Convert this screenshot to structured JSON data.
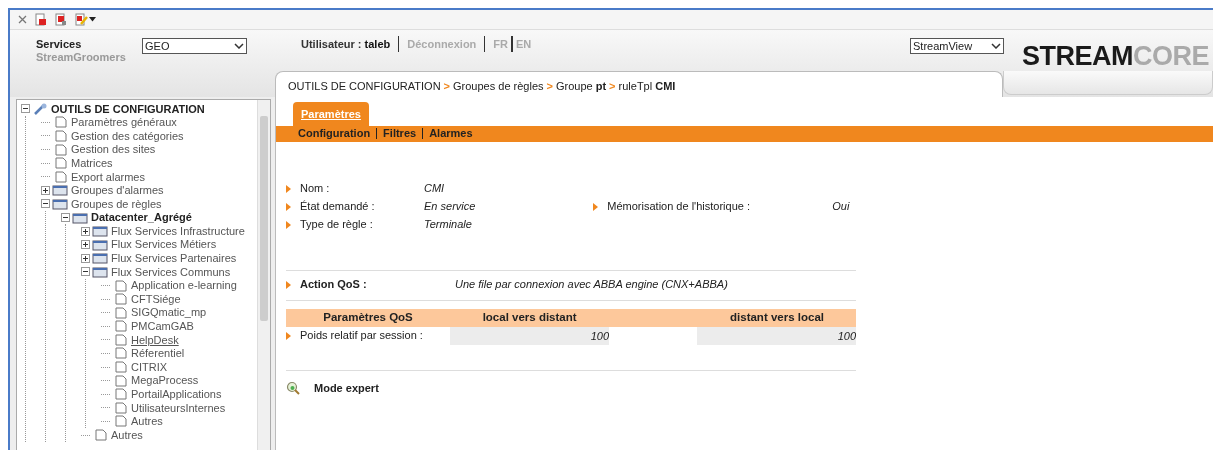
{
  "header": {
    "services_label": "Services",
    "services_sub": "StreamGroomers",
    "services_select": "GEO",
    "user_label": "Utilisateur :",
    "user_name": "taleb",
    "logout": "Déconnexion",
    "languages": [
      "FR",
      "EN"
    ],
    "app_select": "StreamView",
    "logo": [
      "STREAM",
      "CORE"
    ]
  },
  "breadcrumb": [
    {
      "label": "OUTILS DE CONFIGURATION",
      "separator": ">"
    },
    {
      "label": "Groupes de règles",
      "separator": ">"
    },
    {
      "label": "Groupe **pt**",
      "separator": ">"
    },
    {
      "label": "ruleTpl **CMI**"
    }
  ],
  "tree": [
    {
      "label": "OUTILS DE CONFIGURATION",
      "kind": "root",
      "expanded": true,
      "selected": false,
      "children": [
        {
          "label": "Paramètres généraux",
          "kind": "page",
          "selected": false
        },
        {
          "label": "Gestion des catégories",
          "kind": "page",
          "selected": false
        },
        {
          "label": "Gestion des sites",
          "kind": "page",
          "selected": false
        },
        {
          "label": "Matrices",
          "kind": "page",
          "selected": false
        },
        {
          "label": "Export alarmes",
          "kind": "page",
          "selected": false
        },
        {
          "label": "Groupes d'alarmes",
          "kind": "folder",
          "expanded": false,
          "selected": false
        },
        {
          "label": "Groupes de règles",
          "kind": "folder",
          "expanded": true,
          "selected": false,
          "children": [
            {
              "label": "Datacenter_Agrégé",
              "kind": "group",
              "expanded": true,
              "selected": false,
              "children": [
                {
                  "label": "Flux Services Infrastructure",
                  "kind": "folder",
                  "expanded": false,
                  "selected": false
                },
                {
                  "label": "Flux Services Métiers",
                  "kind": "folder",
                  "expanded": false,
                  "selected": false
                },
                {
                  "label": "Flux Services Partenaires",
                  "kind": "folder",
                  "expanded": false,
                  "selected": false
                },
                {
                  "label": "Flux Services Communs",
                  "kind": "folder",
                  "expanded": true,
                  "selected": false,
                  "children": [
                    {
                      "label": "Application e-learning",
                      "kind": "page",
                      "selected": false
                    },
                    {
                      "label": "CFTSiége",
                      "kind": "page",
                      "selected": false
                    },
                    {
                      "label": "SIGQmatic_mp",
                      "kind": "page",
                      "selected": false
                    },
                    {
                      "label": "PMCamGAB",
                      "kind": "page",
                      "selected": false
                    },
                    {
                      "label": "HelpDesk",
                      "kind": "page",
                      "selected": true
                    },
                    {
                      "label": "Réferentiel",
                      "kind": "page",
                      "selected": false
                    },
                    {
                      "label": "CITRIX",
                      "kind": "page",
                      "selected": false
                    },
                    {
                      "label": "MegaProcess",
                      "kind": "page",
                      "selected": false
                    },
                    {
                      "label": "PortailApplications",
                      "kind": "page",
                      "selected": false
                    },
                    {
                      "label": "UtilisateursInternes",
                      "kind": "page",
                      "selected": false
                    },
                    {
                      "label": "Autres",
                      "kind": "page",
                      "selected": false
                    }
                  ]
                },
                {
                  "label": "Autres",
                  "kind": "page",
                  "selected": false
                }
              ]
            }
          ]
        }
      ]
    }
  ],
  "tabs": [
    {
      "label": "Paramètres",
      "selected": true
    }
  ],
  "subtabs": [
    "Configuration",
    "Filtres",
    "Alarmes"
  ],
  "fields": [
    {
      "label": "Nom :",
      "value": "CMI"
    },
    {
      "label": "État demandé :",
      "value": "En service"
    },
    {
      "label": "Type de règle :",
      "value": "Terminale"
    }
  ],
  "side_fields": [
    {
      "label": "Mémorisation de l'historique :",
      "value": "Oui"
    }
  ],
  "action_qos": {
    "label": "Action QoS :",
    "value": "Une file par connexion avec ABBA engine (CNX+ABBA)"
  },
  "qos_table": {
    "columns": [
      "Paramètres QoS",
      "local vers distant",
      "distant vers local"
    ],
    "rows": [
      {
        "label": "Poids relatif par session :",
        "cells": [
          "100",
          "100"
        ]
      }
    ]
  },
  "mode_expert": "Mode expert"
}
